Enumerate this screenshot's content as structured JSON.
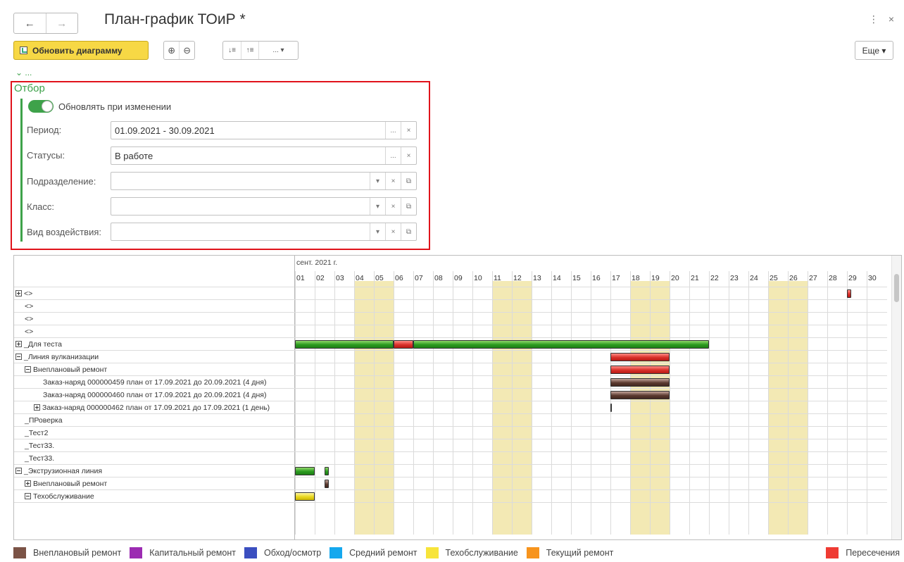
{
  "window": {
    "title": "План-график ТОиР *",
    "nav_back": "←",
    "nav_forward": "→",
    "menu_icon": "⋮",
    "close_icon": "×"
  },
  "toolbar": {
    "refresh_label": "Обновить диаграмму",
    "zoom_in": "⊕",
    "zoom_out": "⊖",
    "expand_all": "↓≡",
    "collapse_all": "↑≡",
    "dots": "... ▾",
    "more_label": "Еще ▾"
  },
  "collapse_label": "⌄ ...",
  "filter": {
    "title": "Отбор",
    "auto_update_label": "Обновлять при изменении",
    "auto_update_on": true,
    "fields": [
      {
        "label": "Период:",
        "value": "01.09.2021 - 30.09.2021",
        "buttons": [
          "...",
          "×"
        ]
      },
      {
        "label": "Статусы:",
        "value": "В работе",
        "buttons": [
          "...",
          "×"
        ]
      },
      {
        "label": "Подразделение:",
        "value": "",
        "buttons": [
          "▾",
          "×",
          "⧉"
        ]
      },
      {
        "label": "Класс:",
        "value": "",
        "buttons": [
          "▾",
          "×",
          "⧉"
        ]
      },
      {
        "label": "Вид воздействия:",
        "value": "",
        "buttons": [
          "▾",
          "×",
          "⧉"
        ]
      }
    ]
  },
  "gantt": {
    "month": "сент. 2021 г.",
    "days": [
      "01",
      "02",
      "03",
      "04",
      "05",
      "06",
      "07",
      "08",
      "09",
      "10",
      "11",
      "12",
      "13",
      "14",
      "15",
      "16",
      "17",
      "18",
      "19",
      "20",
      "21",
      "22",
      "23",
      "24",
      "25",
      "26",
      "27",
      "28",
      "29",
      "30"
    ],
    "weekend_days": [
      4,
      5,
      11,
      12,
      18,
      19,
      25,
      26
    ],
    "rows": [
      {
        "label": "<>",
        "indent": 0,
        "toggle": "plus"
      },
      {
        "label": "<>",
        "indent": 1,
        "toggle": ""
      },
      {
        "label": "<>",
        "indent": 1,
        "toggle": ""
      },
      {
        "label": "<>",
        "indent": 1,
        "toggle": ""
      },
      {
        "label": "_Для теста",
        "indent": 0,
        "toggle": "plus"
      },
      {
        "label": "_Линия вулканизации",
        "indent": 0,
        "toggle": "minus"
      },
      {
        "label": "Внеплановый ремонт",
        "indent": 1,
        "toggle": "minus"
      },
      {
        "label": "Заказ-наряд 000000459 план от 17.09.2021 до 20.09.2021 (4 дня)",
        "indent": 3,
        "toggle": ""
      },
      {
        "label": "Заказ-наряд 000000460 план от 17.09.2021 до 20.09.2021 (4 дня)",
        "indent": 3,
        "toggle": ""
      },
      {
        "label": "Заказ-наряд 000000462 план от 17.09.2021 до 17.09.2021 (1 день)",
        "indent": 2,
        "toggle": "plus"
      },
      {
        "label": "_ПРоверка",
        "indent": 1,
        "toggle": ""
      },
      {
        "label": "_Тест2",
        "indent": 1,
        "toggle": ""
      },
      {
        "label": "_Тест33.",
        "indent": 1,
        "toggle": ""
      },
      {
        "label": "_Тест33.",
        "indent": 1,
        "toggle": ""
      },
      {
        "label": "_Экструзионная линия",
        "indent": 0,
        "toggle": "minus"
      },
      {
        "label": "Внеплановый ремонт",
        "indent": 1,
        "toggle": "plus"
      },
      {
        "label": "Техобслуживание",
        "indent": 1,
        "toggle": "minus"
      }
    ],
    "bars": [
      {
        "row": 0,
        "start": 29.0,
        "end": 29.2,
        "color": "red"
      },
      {
        "row": 4,
        "start": 1.0,
        "end": 6.0,
        "color": "green"
      },
      {
        "row": 4,
        "start": 6.0,
        "end": 7.0,
        "color": "red"
      },
      {
        "row": 4,
        "start": 7.0,
        "end": 22.0,
        "color": "green"
      },
      {
        "row": 5,
        "start": 17.0,
        "end": 20.0,
        "color": "red"
      },
      {
        "row": 6,
        "start": 17.0,
        "end": 20.0,
        "color": "red"
      },
      {
        "row": 7,
        "start": 17.0,
        "end": 20.0,
        "color": "brown"
      },
      {
        "row": 8,
        "start": 17.0,
        "end": 20.0,
        "color": "brown"
      },
      {
        "row": 9,
        "start": 17.0,
        "end": 17.05,
        "color": "brown"
      },
      {
        "row": 14,
        "start": 1.0,
        "end": 2.0,
        "color": "green"
      },
      {
        "row": 14,
        "start": 2.5,
        "end": 2.7,
        "color": "green"
      },
      {
        "row": 15,
        "start": 2.5,
        "end": 2.7,
        "color": "brown"
      },
      {
        "row": 16,
        "start": 1.0,
        "end": 2.0,
        "color": "yellow"
      }
    ]
  },
  "legend": {
    "items": [
      {
        "label": "Внеплановый ремонт",
        "color": "#7b5346"
      },
      {
        "label": "Капитальный ремонт",
        "color": "#9c2bb2"
      },
      {
        "label": "Обход/осмотр",
        "color": "#3b4fc0"
      },
      {
        "label": "Средний ремонт",
        "color": "#15a8ee"
      },
      {
        "label": "Техобслуживание",
        "color": "#f7e43a"
      },
      {
        "label": "Текущий ремонт",
        "color": "#f7941d"
      }
    ],
    "right": {
      "label": "Пересечения",
      "color": "#ef3b33"
    }
  }
}
